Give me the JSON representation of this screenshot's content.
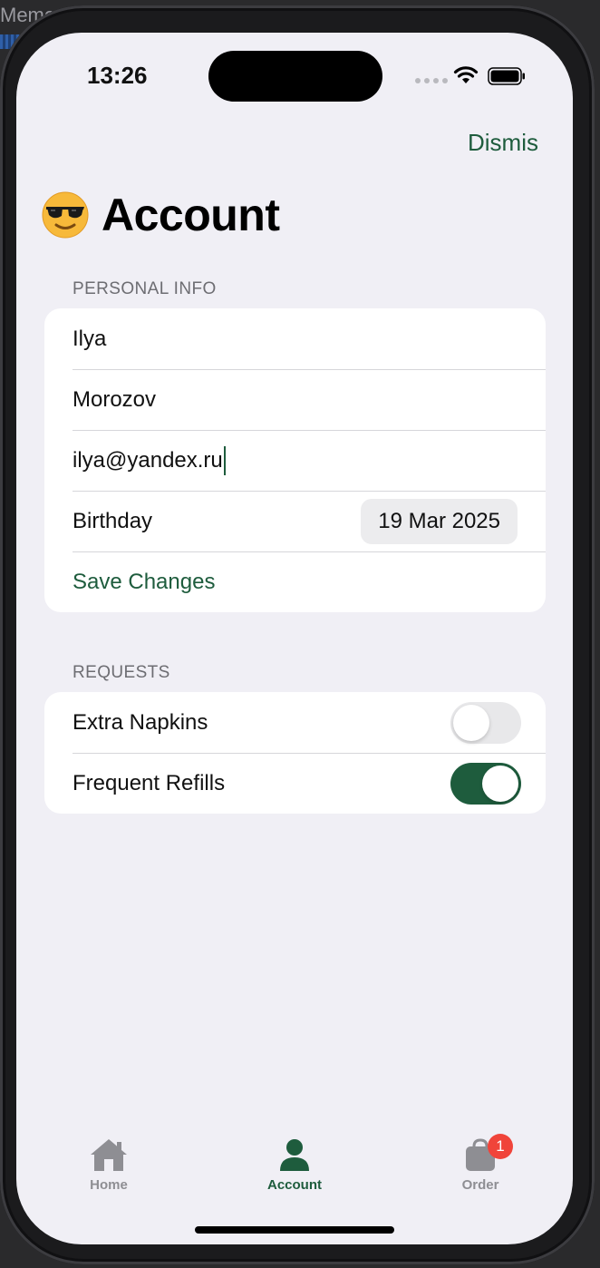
{
  "background": {
    "window_label": "Memor"
  },
  "status_bar": {
    "time": "13:26"
  },
  "nav": {
    "dismiss_label": "Dismis"
  },
  "page": {
    "title": "Account",
    "title_icon": "sunglasses-emoji"
  },
  "personal_info": {
    "header": "PERSONAL INFO",
    "first_name": "Ilya",
    "last_name": "Morozov",
    "email": "ilya@yandex.ru",
    "birthday_label": "Birthday",
    "birthday_value": "19 Mar 2025",
    "save_label": "Save Changes"
  },
  "requests": {
    "header": "REQUESTS",
    "items": [
      {
        "label": "Extra Napkins",
        "enabled": false
      },
      {
        "label": "Frequent Refills",
        "enabled": true
      }
    ]
  },
  "tabs": [
    {
      "label": "Home",
      "icon": "house-icon",
      "active": false
    },
    {
      "label": "Account",
      "icon": "person-icon",
      "active": true
    },
    {
      "label": "Order",
      "icon": "bag-icon",
      "active": false,
      "badge": "1"
    }
  ],
  "colors": {
    "accent": "#1e5c3d",
    "badge": "#f0443a",
    "background": "#f0eff5"
  }
}
